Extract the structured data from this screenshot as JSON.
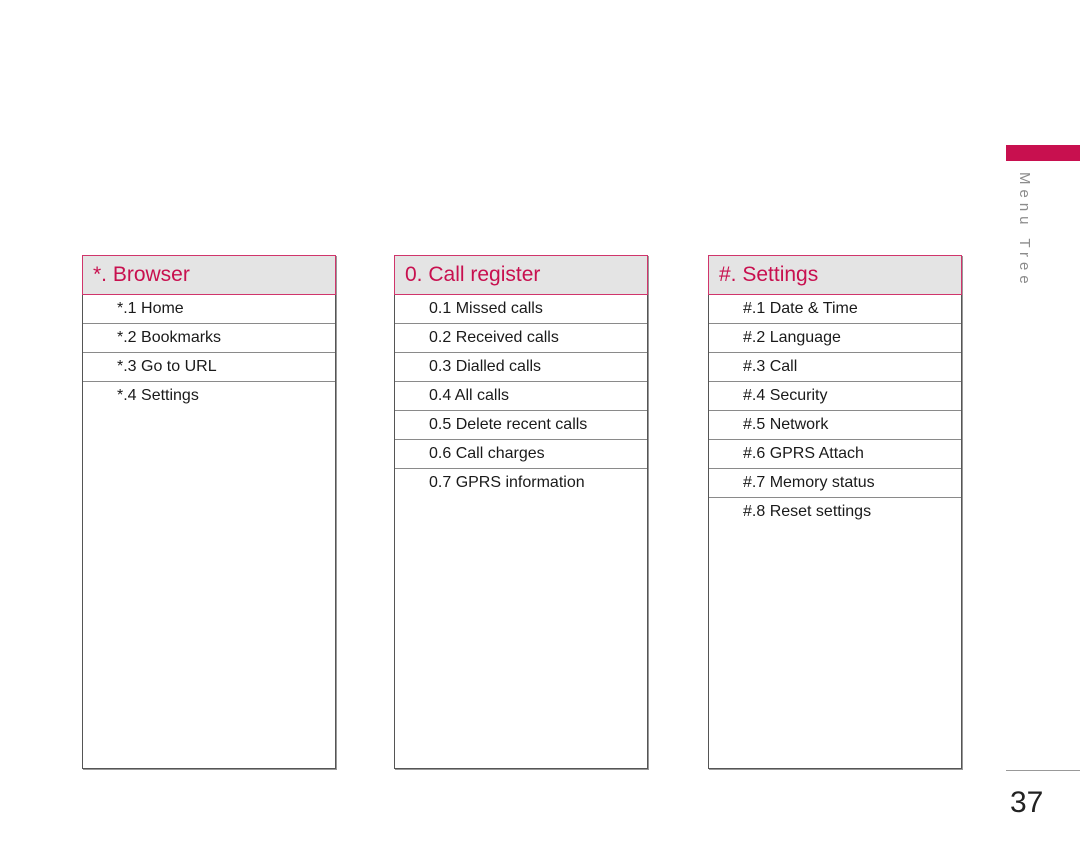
{
  "side_label": "Menu Tree",
  "page_number": "37",
  "accent_color": "#c8104f",
  "panels": [
    {
      "title": "*. Browser",
      "items": [
        "*.1 Home",
        "*.2 Bookmarks",
        "*.3 Go to URL",
        "*.4 Settings"
      ]
    },
    {
      "title": "0. Call register",
      "items": [
        "0.1 Missed calls",
        "0.2 Received calls",
        "0.3 Dialled calls",
        "0.4 All calls",
        "0.5 Delete recent calls",
        "0.6 Call charges",
        "0.7 GPRS information"
      ]
    },
    {
      "title": "#. Settings",
      "items": [
        "#.1 Date & Time",
        "#.2 Language",
        "#.3 Call",
        "#.4 Security",
        "#.5 Network",
        "#.6 GPRS Attach",
        "#.7 Memory status",
        "#.8 Reset settings"
      ]
    }
  ]
}
